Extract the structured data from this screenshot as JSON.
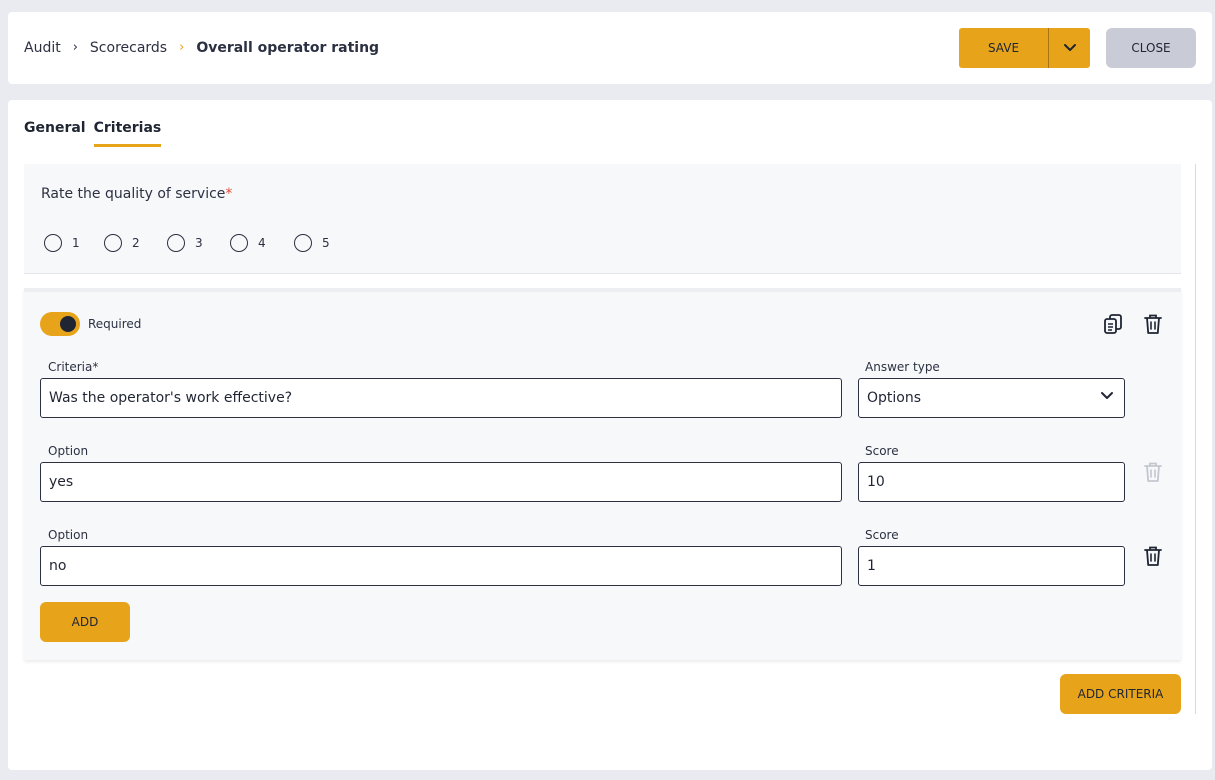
{
  "breadcrumb": {
    "items": [
      "Audit",
      "Scorecards",
      "Overall operator rating"
    ]
  },
  "header": {
    "save_label": "SAVE",
    "close_label": "CLOSE"
  },
  "tabs": [
    {
      "label": "General",
      "active": false
    },
    {
      "label": "Criterias",
      "active": true
    }
  ],
  "question": {
    "label": "Rate the quality of service",
    "required_mark": "*",
    "options": [
      "1",
      "2",
      "3",
      "4",
      "5"
    ]
  },
  "criteria_card": {
    "required_label": "Required",
    "required_on": true,
    "criteria_label": "Criteria*",
    "criteria_value": "Was the operator's work effective?",
    "answer_type_label": "Answer type",
    "answer_type_value": "Options",
    "options": [
      {
        "option_label": "Option",
        "option_value": "yes",
        "score_label": "Score",
        "score_value": "10",
        "delete_enabled": false
      },
      {
        "option_label": "Option",
        "option_value": "no",
        "score_label": "Score",
        "score_value": "1",
        "delete_enabled": true
      }
    ],
    "add_label": "ADD"
  },
  "add_criteria_label": "ADD CRITERIA",
  "colors": {
    "accent": "#e7a41a",
    "text": "#1f2533",
    "close_bg": "#c9cbd6",
    "required": "#e04a3a"
  },
  "icons": [
    "chevron-right-icon",
    "chevron-down-icon",
    "copy-icon",
    "trash-icon"
  ]
}
